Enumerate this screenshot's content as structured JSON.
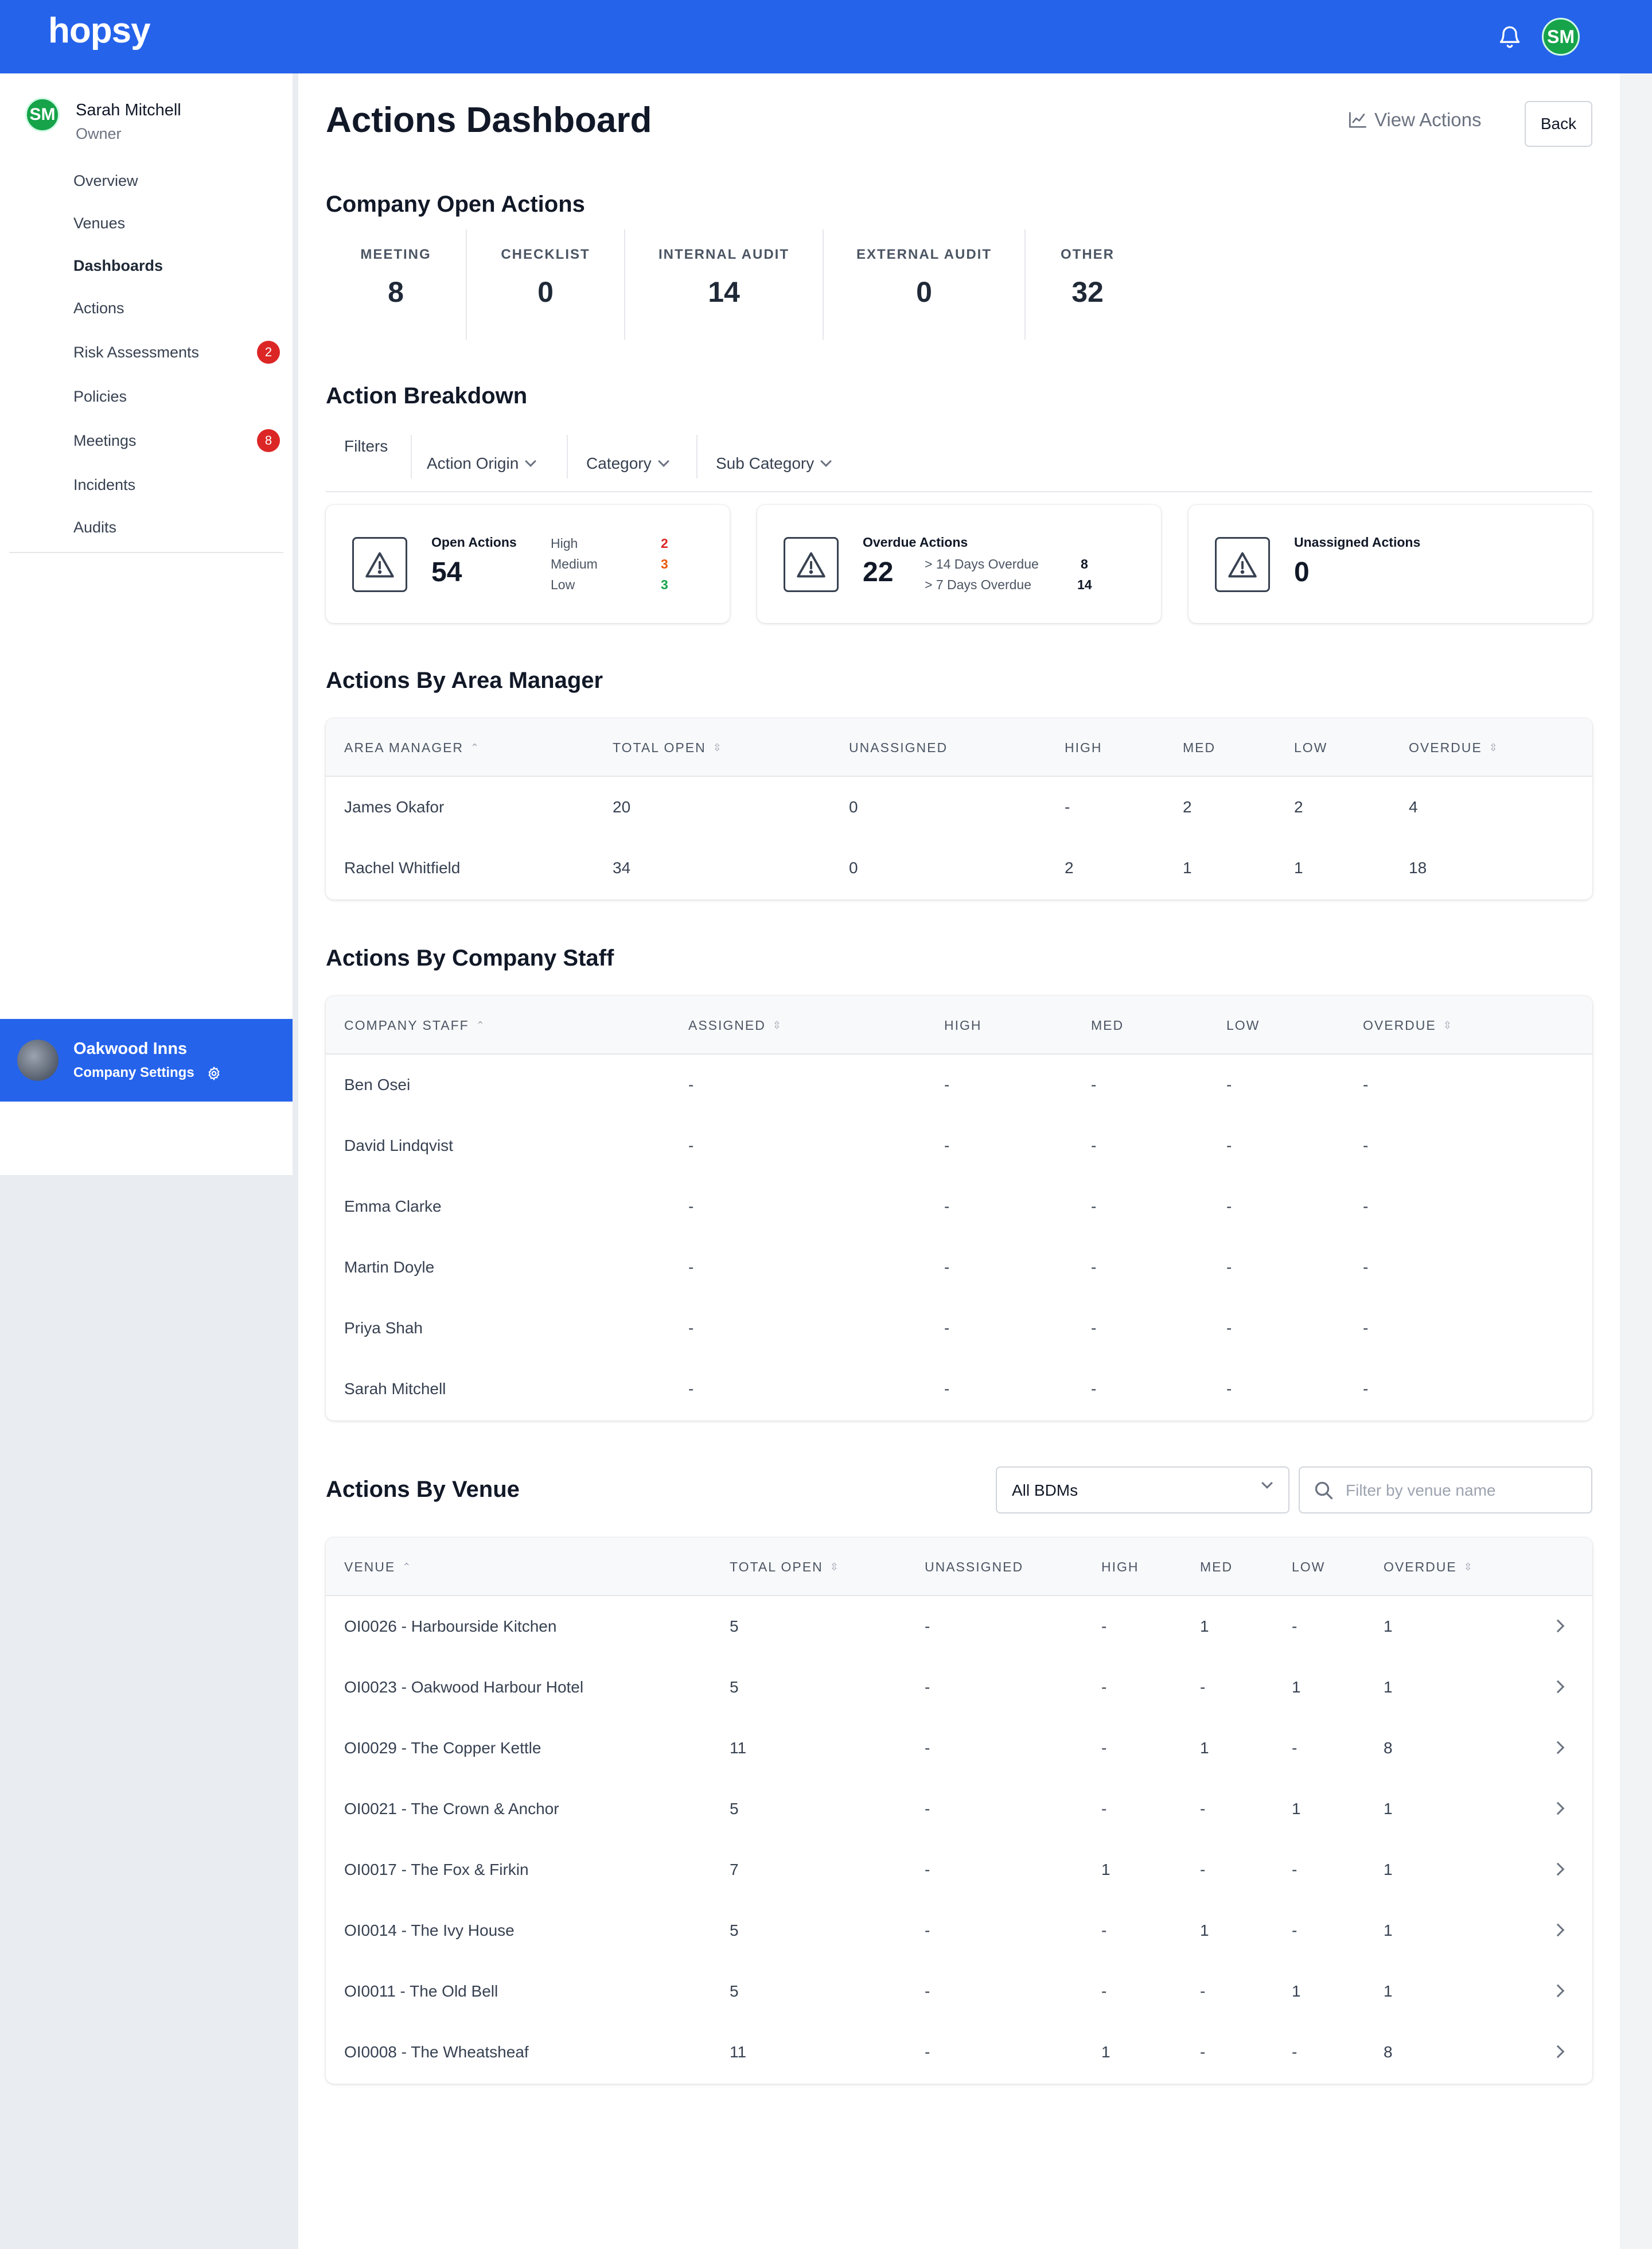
{
  "app": {
    "logo": "hopsy",
    "user_initials": "SM"
  },
  "sidebar": {
    "user": {
      "initials": "SM",
      "name": "Sarah Mitchell",
      "role": "Owner"
    },
    "items": [
      {
        "label": "Overview",
        "badge": ""
      },
      {
        "label": "Venues",
        "badge": ""
      },
      {
        "label": "Dashboards",
        "badge": "",
        "active": true
      },
      {
        "label": "Actions",
        "badge": ""
      },
      {
        "label": "Risk Assessments",
        "badge": "2"
      },
      {
        "label": "Policies",
        "badge": ""
      },
      {
        "label": "Meetings",
        "badge": "8"
      },
      {
        "label": "Incidents",
        "badge": ""
      },
      {
        "label": "Audits",
        "badge": ""
      }
    ],
    "company": {
      "name": "Oakwood Inns",
      "settings_label": "Company Settings"
    }
  },
  "header": {
    "title": "Actions Dashboard",
    "view_actions_label": "View Actions",
    "back_label": "Back"
  },
  "open_actions": {
    "title": "Company Open Actions",
    "stats": [
      {
        "label": "MEETING",
        "value": "8"
      },
      {
        "label": "CHECKLIST",
        "value": "0"
      },
      {
        "label": "INTERNAL AUDIT",
        "value": "14"
      },
      {
        "label": "EXTERNAL AUDIT",
        "value": "0"
      },
      {
        "label": "OTHER",
        "value": "32"
      }
    ]
  },
  "breakdown": {
    "title": "Action Breakdown",
    "filters_label": "Filters",
    "filters": [
      "Action Origin",
      "Category",
      "Sub Category"
    ],
    "cards": {
      "open": {
        "title": "Open Actions",
        "value": "54",
        "high_label": "High",
        "high": "2",
        "medium_label": "Medium",
        "medium": "3",
        "low_label": "Low",
        "low": "3"
      },
      "overdue": {
        "title": "Overdue Actions",
        "value": "22",
        "over14_label": "> 14 Days Overdue",
        "over14": "8",
        "over7_label": "> 7 Days Overdue",
        "over7": "14"
      },
      "unassigned": {
        "title": "Unassigned Actions",
        "value": "0"
      }
    },
    "colors": {
      "high": "#dc2626",
      "medium": "#ea580c",
      "low": "#16a34a"
    }
  },
  "area_manager": {
    "title": "Actions By Area Manager",
    "headers": [
      "AREA MANAGER",
      "TOTAL OPEN",
      "UNASSIGNED",
      "HIGH",
      "MED",
      "LOW",
      "OVERDUE"
    ],
    "rows": [
      [
        "James Okafor",
        "20",
        "0",
        "-",
        "2",
        "2",
        "4"
      ],
      [
        "Rachel Whitfield",
        "34",
        "0",
        "2",
        "1",
        "1",
        "18"
      ]
    ]
  },
  "company_staff": {
    "title": "Actions By Company Staff",
    "headers": [
      "COMPANY STAFF",
      "ASSIGNED",
      "HIGH",
      "MED",
      "LOW",
      "OVERDUE"
    ],
    "rows": [
      [
        "Ben Osei",
        "-",
        "-",
        "-",
        "-",
        "-"
      ],
      [
        "David Lindqvist",
        "-",
        "-",
        "-",
        "-",
        "-"
      ],
      [
        "Emma Clarke",
        "-",
        "-",
        "-",
        "-",
        "-"
      ],
      [
        "Martin Doyle",
        "-",
        "-",
        "-",
        "-",
        "-"
      ],
      [
        "Priya Shah",
        "-",
        "-",
        "-",
        "-",
        "-"
      ],
      [
        "Sarah Mitchell",
        "-",
        "-",
        "-",
        "-",
        "-"
      ]
    ]
  },
  "venues": {
    "title": "Actions By Venue",
    "bdm_select": "All BDMs",
    "search_placeholder": "Filter by venue name",
    "headers": [
      "VENUE",
      "TOTAL OPEN",
      "UNASSIGNED",
      "HIGH",
      "MED",
      "LOW",
      "OVERDUE"
    ],
    "rows": [
      [
        "OI0026 - Harbourside Kitchen",
        "5",
        "-",
        "-",
        "1",
        "-",
        "1"
      ],
      [
        "OI0023 - Oakwood Harbour Hotel",
        "5",
        "-",
        "-",
        "-",
        "1",
        "1"
      ],
      [
        "OI0029 - The Copper Kettle",
        "11",
        "-",
        "-",
        "1",
        "-",
        "8"
      ],
      [
        "OI0021 - The Crown & Anchor",
        "5",
        "-",
        "-",
        "-",
        "1",
        "1"
      ],
      [
        "OI0017 - The Fox & Firkin",
        "7",
        "-",
        "1",
        "-",
        "-",
        "1"
      ],
      [
        "OI0014 - The Ivy House",
        "5",
        "-",
        "-",
        "1",
        "-",
        "1"
      ],
      [
        "OI0011 - The Old Bell",
        "5",
        "-",
        "-",
        "-",
        "1",
        "1"
      ],
      [
        "OI0008 - The Wheatsheaf",
        "11",
        "-",
        "1",
        "-",
        "-",
        "8"
      ]
    ]
  }
}
